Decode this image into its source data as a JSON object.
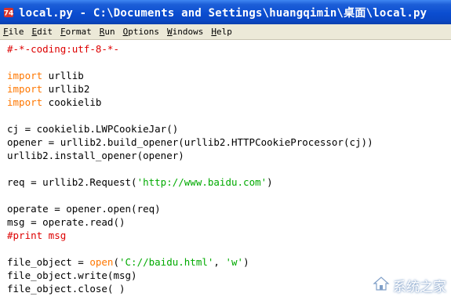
{
  "window": {
    "title": "local.py - C:\\Documents and Settings\\huangqimin\\桌面\\local.py"
  },
  "menu": {
    "items": [
      "File",
      "Edit",
      "Format",
      "Run",
      "Options",
      "Windows",
      "Help"
    ]
  },
  "editor": {
    "lines": [
      [
        {
          "t": "#-*-coding:utf-8-*-",
          "c": "com"
        }
      ],
      [],
      [
        {
          "t": "import",
          "c": "kw"
        },
        {
          "t": " urllib",
          "c": ""
        }
      ],
      [
        {
          "t": "import",
          "c": "kw"
        },
        {
          "t": " urllib2",
          "c": ""
        }
      ],
      [
        {
          "t": "import",
          "c": "kw"
        },
        {
          "t": " cookielib",
          "c": ""
        }
      ],
      [],
      [
        {
          "t": "cj = cookielib.LWPCookieJar()",
          "c": ""
        }
      ],
      [
        {
          "t": "opener = urllib2.build_opener(urllib2.HTTPCookieProcessor(cj))",
          "c": ""
        }
      ],
      [
        {
          "t": "urllib2.install_opener(opener)",
          "c": ""
        }
      ],
      [],
      [
        {
          "t": "req = urllib2.Request(",
          "c": ""
        },
        {
          "t": "'http://www.baidu.com'",
          "c": "str"
        },
        {
          "t": ")",
          "c": ""
        }
      ],
      [],
      [
        {
          "t": "operate = opener.open(req)",
          "c": ""
        }
      ],
      [
        {
          "t": "msg = operate.read()",
          "c": ""
        }
      ],
      [
        {
          "t": "#print msg",
          "c": "com"
        }
      ],
      [],
      [
        {
          "t": "file_object = ",
          "c": ""
        },
        {
          "t": "open",
          "c": "kw"
        },
        {
          "t": "(",
          "c": ""
        },
        {
          "t": "'C://baidu.html'",
          "c": "str"
        },
        {
          "t": ", ",
          "c": ""
        },
        {
          "t": "'w'",
          "c": "str"
        },
        {
          "t": ")",
          "c": ""
        }
      ],
      [
        {
          "t": "file_object.write(msg)",
          "c": ""
        }
      ],
      [
        {
          "t": "file_object.close( )",
          "c": ""
        }
      ]
    ]
  },
  "watermark": {
    "text": "系统之家",
    "icon": "house-logo-icon"
  }
}
